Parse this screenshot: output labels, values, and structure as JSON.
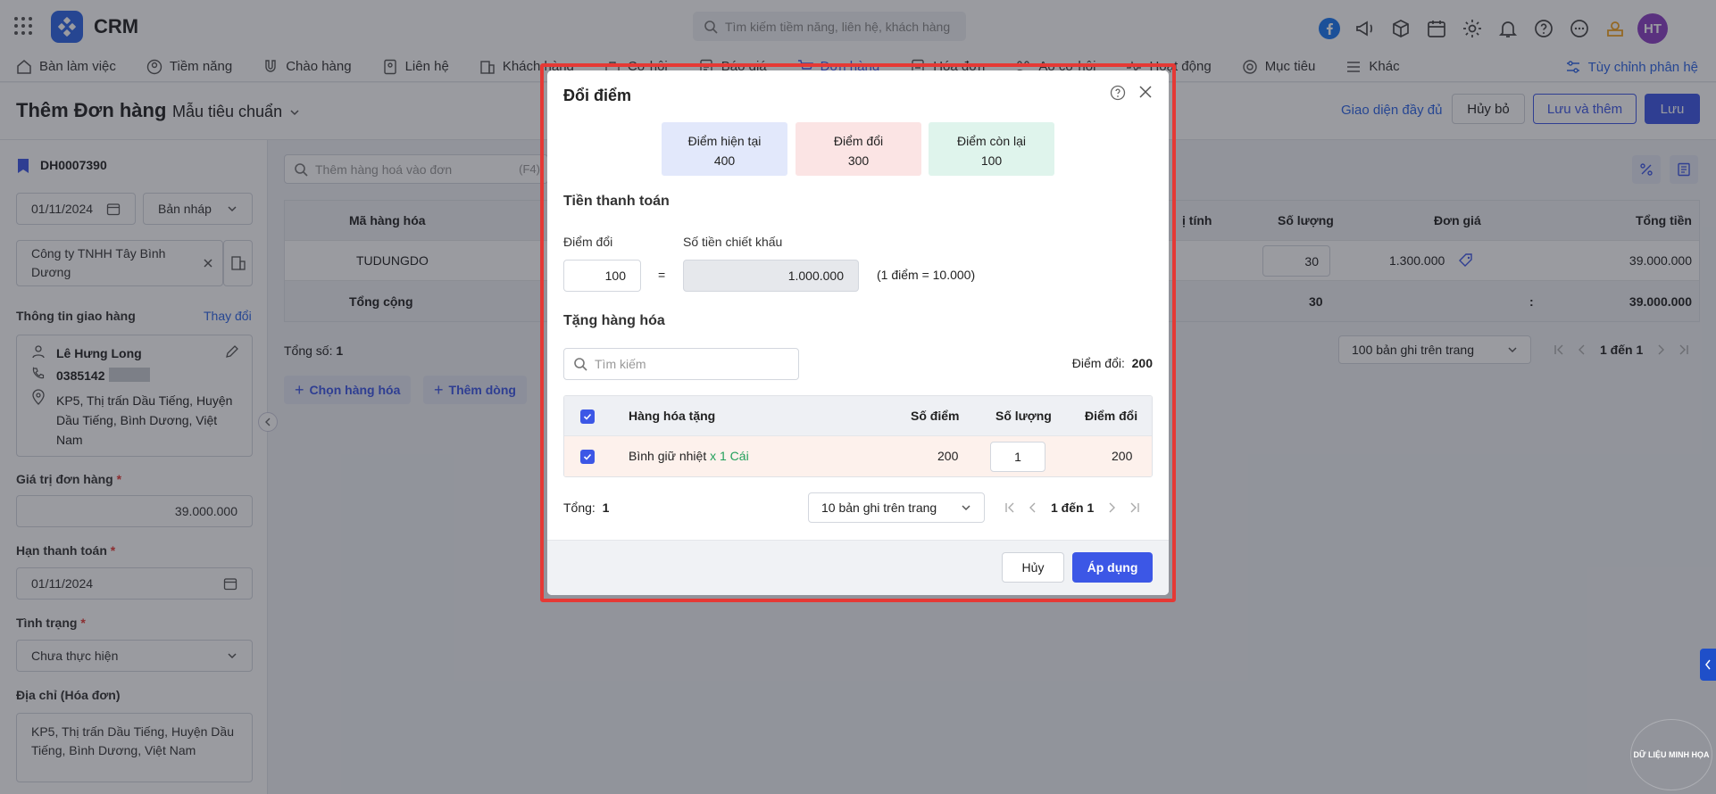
{
  "app": {
    "brand": "CRM",
    "search_placeholder": "Tìm kiếm tiềm năng, liên hệ, khách hàng",
    "avatar_initials": "HT"
  },
  "nav": {
    "items": [
      "Bàn làm việc",
      "Tiềm năng",
      "Chào hàng",
      "Liên hệ",
      "Khách hàng",
      "Cơ hội",
      "Báo giá",
      "Đơn hàng",
      "Hóa đơn",
      "Ao cơ hội",
      "Hoạt động",
      "Mục tiêu",
      "Khác"
    ],
    "customize": "Tùy chỉnh phân hệ"
  },
  "page": {
    "title": "Thêm Đơn hàng",
    "template": "Mẫu tiêu chuẩn",
    "full_view": "Giao diện đầy đủ",
    "cancel": "Hủy bỏ",
    "save_add": "Lưu và thêm",
    "save": "Lưu"
  },
  "left": {
    "order_code": "DH0007390",
    "date": "01/11/2024",
    "status_draft": "Bản nháp",
    "company": "Công ty TNHH Tây Bình Dương",
    "delivery_label": "Thông tin giao hàng",
    "change": "Thay đổi",
    "contact_name": "Lê Hưng Long",
    "phone": "0385142",
    "address": "KP5, Thị trấn Dầu Tiếng, Huyện Dầu Tiếng, Bình Dương, Việt Nam",
    "order_value_label": "Giá trị đơn hàng",
    "order_value": "39.000.000",
    "due_label": "Hạn thanh toán",
    "due_date": "01/11/2024",
    "state_label": "Tình trạng",
    "state_value": "Chưa thực hiện",
    "invoice_addr_label": "Địa chỉ (Hóa đơn)",
    "invoice_addr": "KP5, Thị trấn Dầu Tiếng, Huyện Dầu Tiếng, Bình Dương, Việt Nam",
    "required_mark": "*"
  },
  "main": {
    "search_placeholder": "Thêm hàng hoá vào đơn",
    "shortcut": "(F4)",
    "columns": {
      "code": "Mã hàng hóa",
      "unit": "ị tính",
      "qty": "Số lượng",
      "price": "Đơn giá",
      "total": "Tổng tiền"
    },
    "row": {
      "code": "TUDUNGDO",
      "qty": "30",
      "price": "1.300.000",
      "total": "39.000.000"
    },
    "footer": {
      "label": "Tổng cộng",
      "qty": "30",
      "sep": ":",
      "total": "39.000.000"
    },
    "total_count_label": "Tổng số:",
    "total_count": "1",
    "choose_goods": "Chọn hàng hóa",
    "add_row": "Thêm dòng",
    "page_size": "100 bản ghi trên trang",
    "pager": "1 đến 1"
  },
  "modal": {
    "title": "Đổi điểm",
    "current_label": "Điểm hiện tại",
    "current_value": "400",
    "exchange_label": "Điểm đổi",
    "exchange_value": "300",
    "remain_label": "Điểm còn lại",
    "remain_value": "100",
    "payment_title": "Tiền thanh toán",
    "points_label": "Điểm đổi",
    "discount_label": "Số tiền chiết khấu",
    "points_value": "100",
    "equals": "=",
    "discount_value": "1.000.000",
    "rate": "(1 điểm = 10.000)",
    "gift_title": "Tặng hàng hóa",
    "gift_search_placeholder": "Tìm kiếm",
    "gift_points_label": "Điểm đổi:",
    "gift_points_value": "200",
    "columns": {
      "name": "Hàng hóa tặng",
      "points": "Số điểm",
      "qty": "Số lượng",
      "exchange": "Điểm đổi"
    },
    "row": {
      "name": "Bình giữ nhiệt",
      "unit": "x 1 Cái",
      "points": "200",
      "qty": "1",
      "exchange": "200"
    },
    "total_label": "Tổng:",
    "total_value": "1",
    "page_size": "10 bản ghi trên trang",
    "pager": "1 đến 1",
    "cancel": "Hủy",
    "apply": "Áp dụng"
  },
  "watermark": "DỮ LIỆU MINH HỌA",
  "colors": {
    "accent": "#3c57e6",
    "highlight": "#e53935",
    "overlay": "rgba(30,34,45,0.45)"
  }
}
